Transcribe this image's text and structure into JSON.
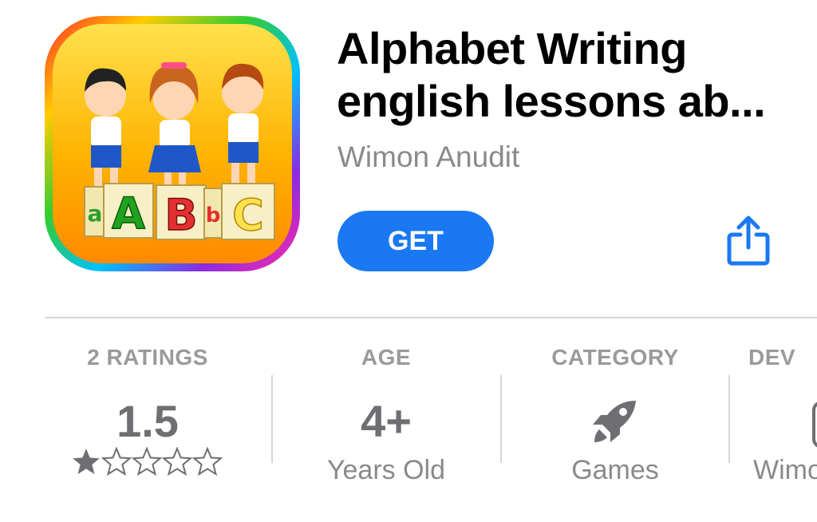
{
  "app": {
    "title_line1": "Alphabet Writing",
    "title_line2": "english lessons ab...",
    "developer": "Wimon Anudit",
    "get_label": "GET",
    "icon_blocks": [
      "a",
      "A",
      "B",
      "b",
      "C"
    ]
  },
  "colors": {
    "accent": "#1a78f2",
    "secondary_text": "#8a8a8e"
  },
  "info": {
    "ratings": {
      "header": "2 RATINGS",
      "value": "1.5",
      "stars_filled": 1.5,
      "stars_total": 5
    },
    "age": {
      "header": "AGE",
      "value": "4+",
      "sub": "Years Old"
    },
    "category": {
      "header": "CATEGORY",
      "icon": "rocket-icon",
      "sub": "Games"
    },
    "developer": {
      "header": "DEV",
      "sub": "Wimo"
    }
  }
}
